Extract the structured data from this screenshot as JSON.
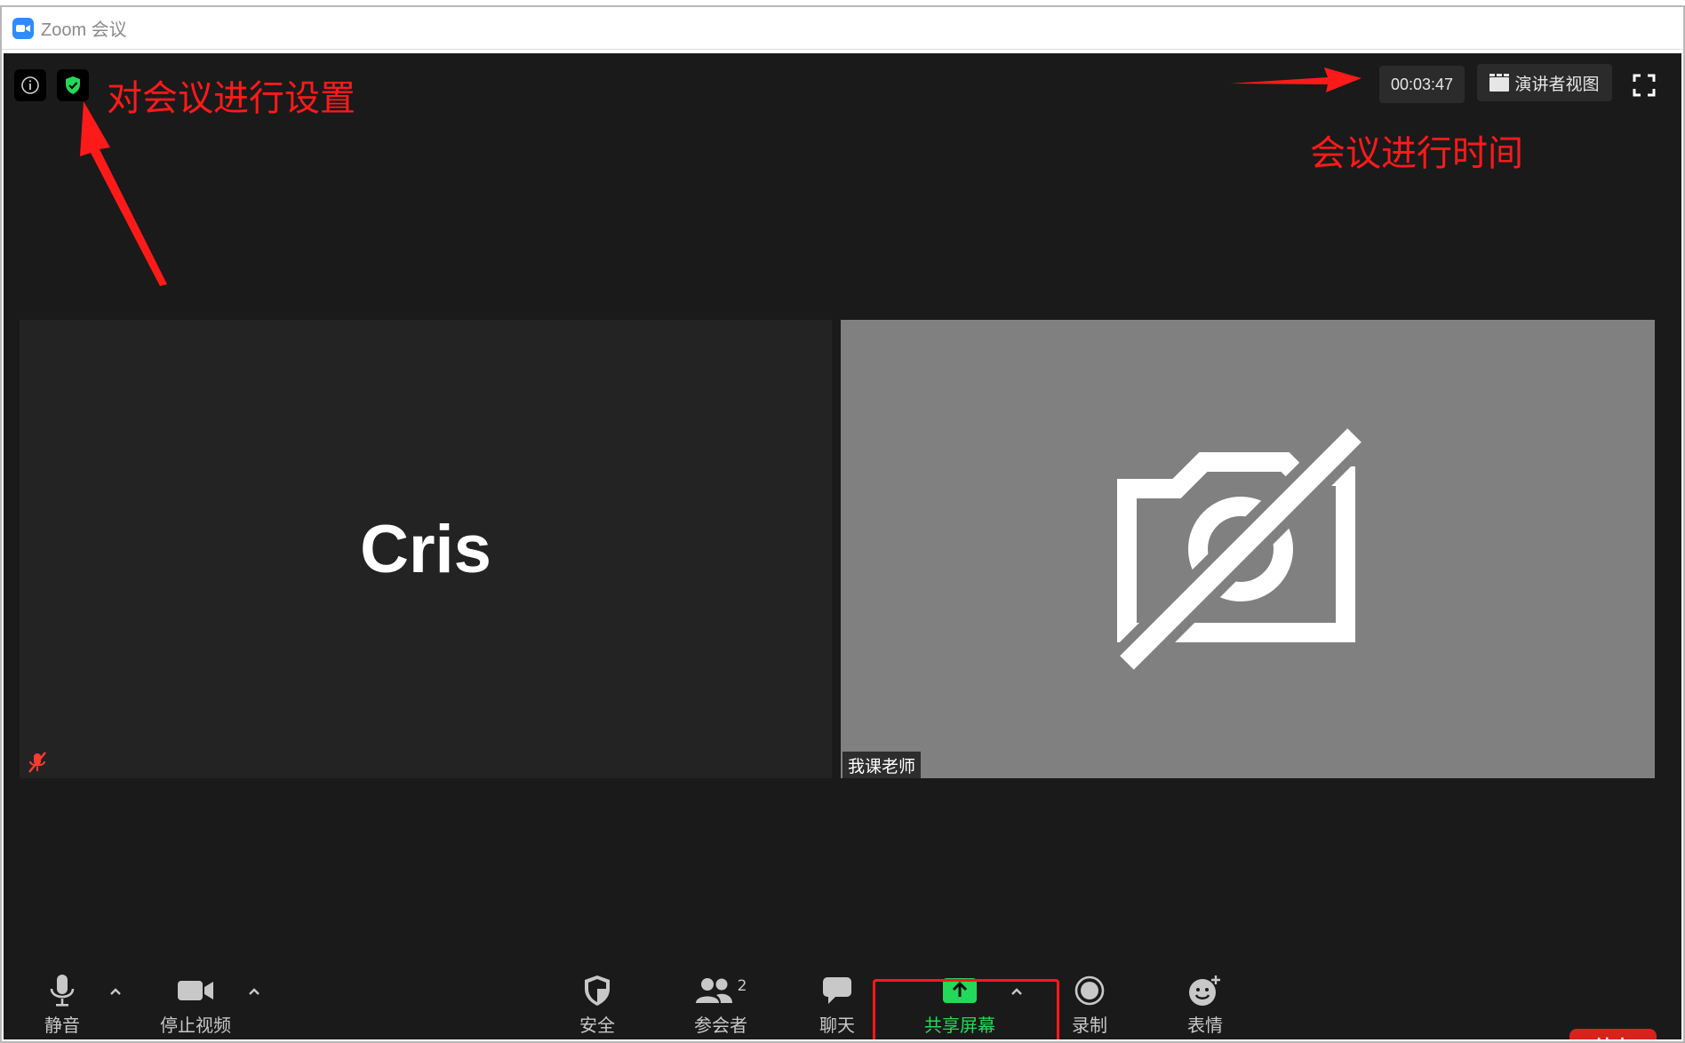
{
  "window": {
    "title": "Zoom 会议"
  },
  "top": {
    "timer": "00:03:47",
    "view_label": "演讲者视图"
  },
  "annotations": {
    "settings_note": "对会议进行设置",
    "time_note": "会议进行时间"
  },
  "participants": [
    {
      "name": "Cris",
      "muted": true,
      "video": false
    },
    {
      "name": "我课老师",
      "video": false
    }
  ],
  "toolbar": {
    "items": [
      {
        "label": "静音",
        "icon": "microphone-icon"
      },
      {
        "label": "停止视频",
        "icon": "video-camera-icon"
      },
      {
        "label": "安全",
        "icon": "shield-icon"
      },
      {
        "label": "参会者",
        "icon": "participants-icon",
        "count": "2"
      },
      {
        "label": "聊天",
        "icon": "chat-icon"
      },
      {
        "label": "共享屏幕",
        "icon": "share-screen-icon"
      },
      {
        "label": "录制",
        "icon": "record-icon"
      },
      {
        "label": "表情",
        "icon": "emoji-icon"
      }
    ],
    "end_label": "结束"
  },
  "colors": {
    "accent_green": "#23d959",
    "end_red": "#d9221c",
    "annotation_red": "#ff1a1a"
  }
}
